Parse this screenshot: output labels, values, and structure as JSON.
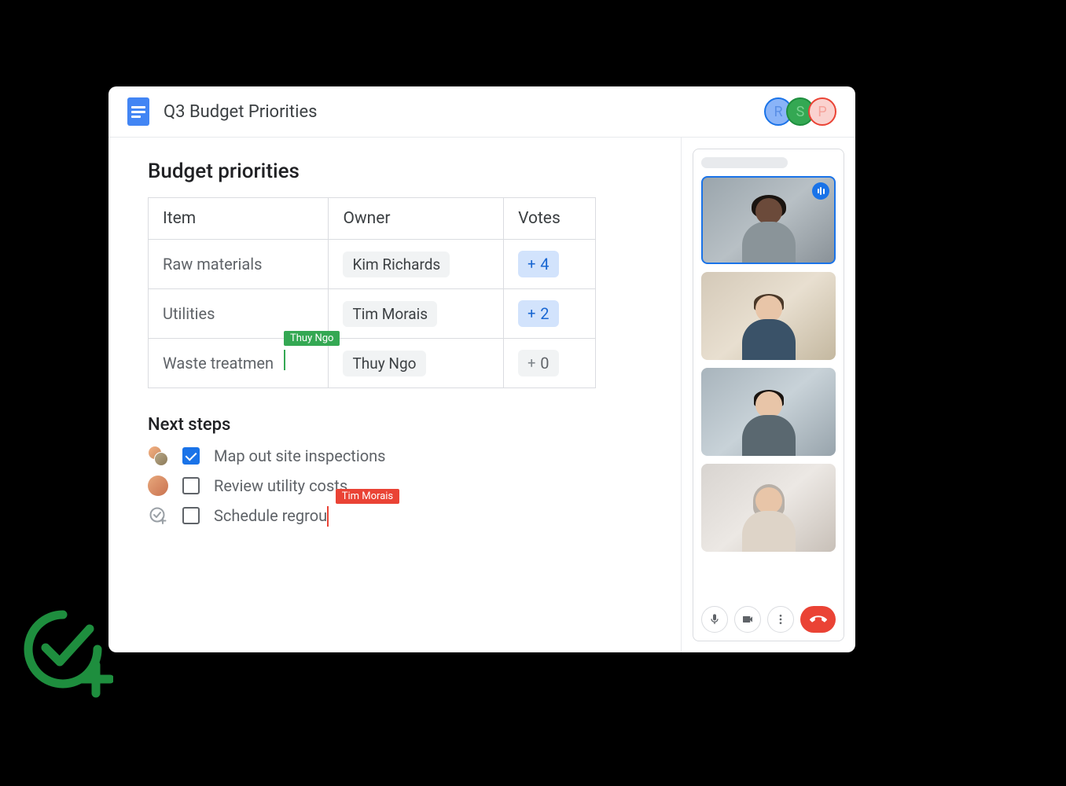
{
  "header": {
    "title": "Q3 Budget Priorities",
    "collaborators": [
      {
        "initial": "R",
        "class": "avatar-r"
      },
      {
        "initial": "S",
        "class": "avatar-s"
      },
      {
        "initial": "P",
        "class": "avatar-p"
      }
    ]
  },
  "doc": {
    "section1_title": "Budget priorities",
    "table": {
      "headers": {
        "item": "Item",
        "owner": "Owner",
        "votes": "Votes"
      },
      "rows": [
        {
          "item": "Raw materials",
          "owner": "Kim Richards",
          "votes": "4",
          "vote_style": "blue"
        },
        {
          "item": "Utilities",
          "owner": "Tim Morais",
          "votes": "2",
          "vote_style": "blue"
        },
        {
          "item": "Waste treatmen",
          "owner": "Thuy Ngo",
          "votes": "0",
          "vote_style": "gray"
        }
      ]
    },
    "cursor_green_label": "Thuy Ngo",
    "section2_title": "Next steps",
    "steps": [
      {
        "text": "Map out site inspections",
        "checked": true,
        "avatar": "multi"
      },
      {
        "text": "Review utility costs",
        "checked": false,
        "avatar": "single"
      },
      {
        "text": "Schedule regrou",
        "checked": false,
        "avatar": "assign"
      }
    ],
    "cursor_red_label": "Tim Morais"
  },
  "vote_plus": "+"
}
